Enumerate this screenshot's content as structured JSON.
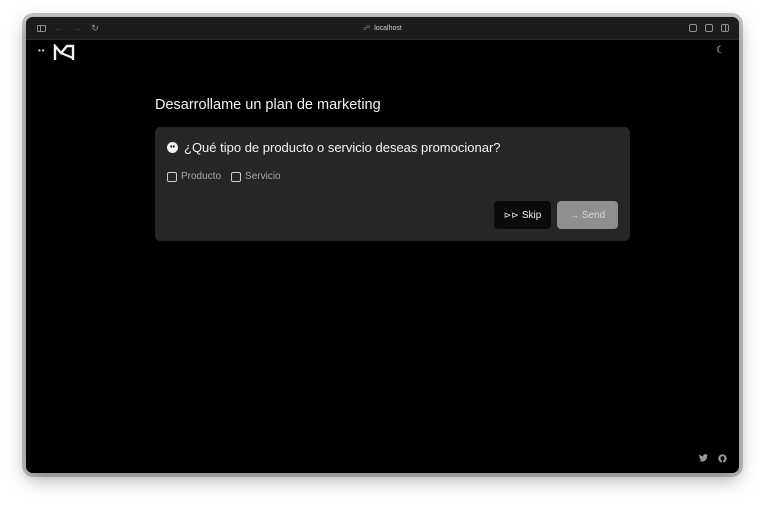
{
  "browser": {
    "url": "localhost",
    "icons": [
      "sidebar-icon",
      "back-icon",
      "forward-icon",
      "reload-icon",
      "share-icon",
      "tabs-icon",
      "split-view-icon"
    ]
  },
  "page": {
    "dots": "••",
    "theme_toggle": "☾",
    "heading": "Desarrollame un plan de marketing",
    "question": {
      "badge": "••",
      "text": "¿Qué tipo de producto o servicio deseas promocionar?",
      "options": [
        "Producto",
        "Servicio"
      ]
    },
    "buttons": {
      "skip_icon": "⊳⊳",
      "skip_label": "Skip",
      "send_icon": "→",
      "send_label": "Send"
    },
    "footer": {
      "twitter_icon": "•",
      "github_icon": "●"
    }
  },
  "colors": {
    "background": "#000000",
    "card": "#262626",
    "send_disabled": "#8f8f8f",
    "skip": "#0b0b0b"
  }
}
